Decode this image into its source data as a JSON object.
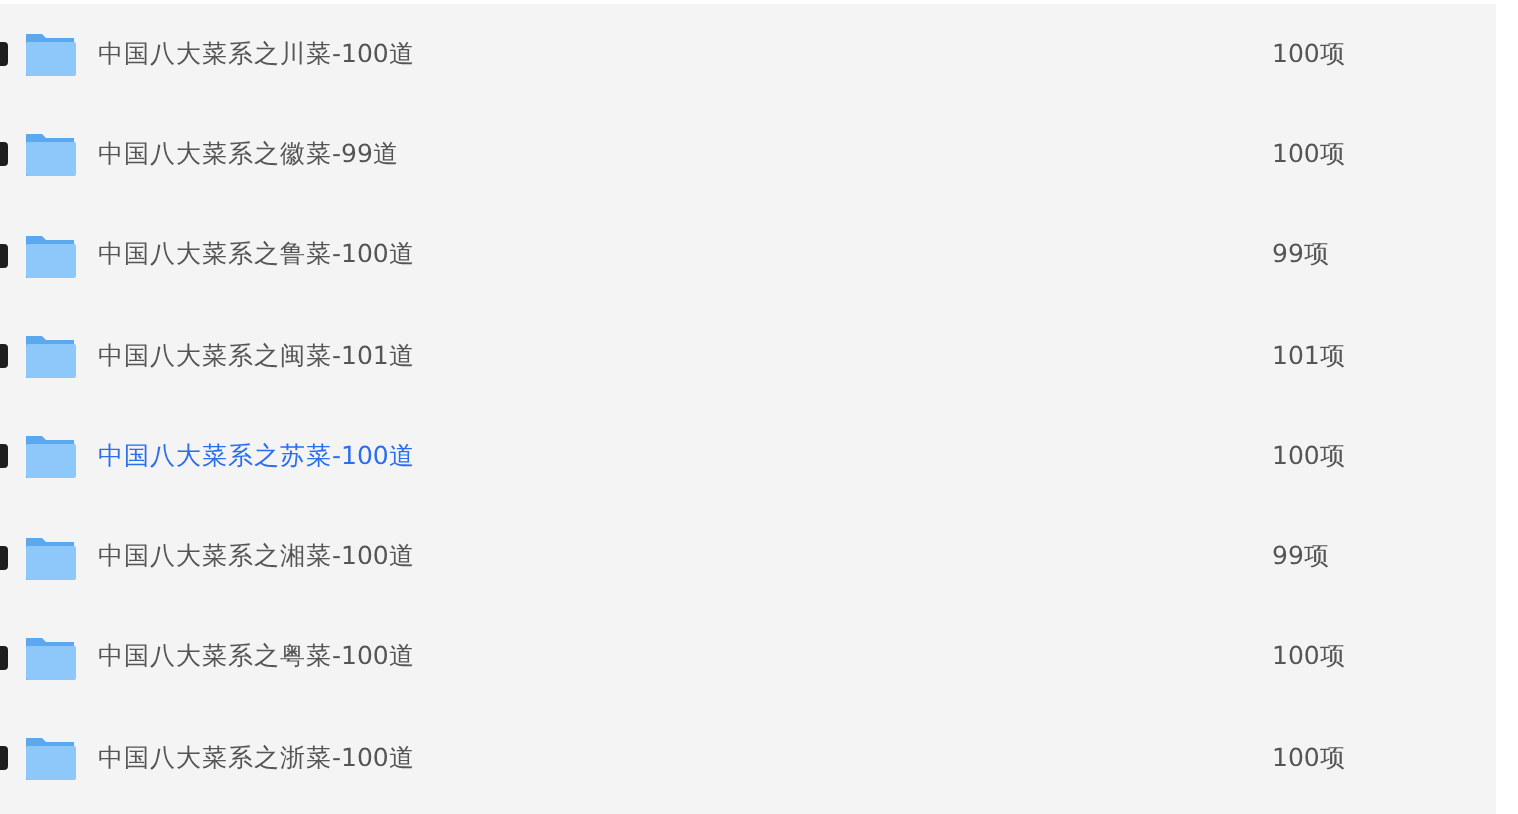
{
  "folders": [
    {
      "name": "中国八大菜系之川菜-100道",
      "count": "100项",
      "hovered": false
    },
    {
      "name": "中国八大菜系之徽菜-99道",
      "count": "100项",
      "hovered": false
    },
    {
      "name": "中国八大菜系之鲁菜-100道",
      "count": "99项",
      "hovered": false
    },
    {
      "name": "中国八大菜系之闽菜-101道",
      "count": "101项",
      "hovered": false
    },
    {
      "name": "中国八大菜系之苏菜-100道",
      "count": "100项",
      "hovered": true
    },
    {
      "name": "中国八大菜系之湘菜-100道",
      "count": "99项",
      "hovered": false
    },
    {
      "name": "中国八大菜系之粤菜-100道",
      "count": "100项",
      "hovered": false
    },
    {
      "name": "中国八大菜系之浙菜-100道",
      "count": "100项",
      "hovered": false
    }
  ]
}
